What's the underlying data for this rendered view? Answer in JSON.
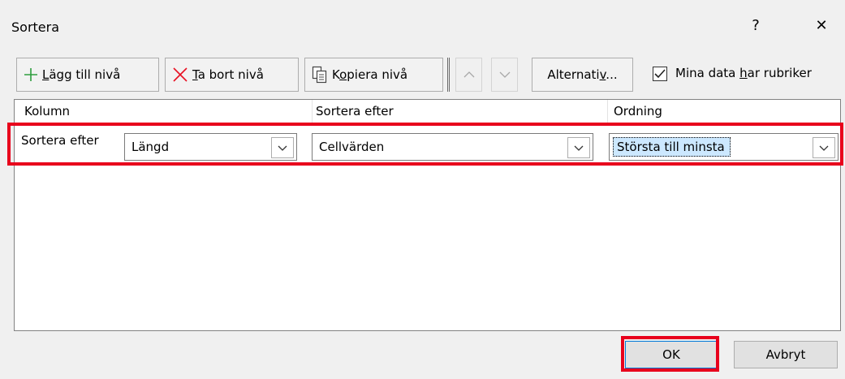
{
  "window": {
    "title": "Sortera",
    "help_label": "?",
    "close_label": "✕"
  },
  "toolbar": {
    "add_level": {
      "prefix": "",
      "underlined": "L",
      "rest": "ägg till nivå",
      "icon": "plus-icon"
    },
    "delete_level": {
      "prefix": "",
      "underlined": "T",
      "rest": "a bort nivå",
      "icon": "x-icon"
    },
    "copy_level": {
      "prefix": "K",
      "underlined": "o",
      "rest": "piera nivå",
      "icon": "copy-icon"
    },
    "move_up_icon": "chevron-up-icon",
    "move_down_icon": "chevron-down-icon",
    "options": {
      "prefix": "Alternati",
      "underlined": "v",
      "rest": "..."
    },
    "headers_checkbox": {
      "prefix": "Mina data ",
      "underlined": "h",
      "rest": "ar rubriker",
      "checked": true
    }
  },
  "columns": {
    "col1": "Kolumn",
    "col2": "Sortera efter",
    "col3": "Ordning"
  },
  "row": {
    "label": "Sortera efter",
    "column_value": "Längd",
    "sort_on_value": "Cellvärden",
    "order_value": "Största till minsta"
  },
  "buttons": {
    "ok": "OK",
    "cancel": "Avbryt"
  },
  "colors": {
    "highlight_red": "#e8001c",
    "plus_green": "#2e9e3e",
    "x_red": "#e81123",
    "selection_blue": "#cce8ff"
  }
}
